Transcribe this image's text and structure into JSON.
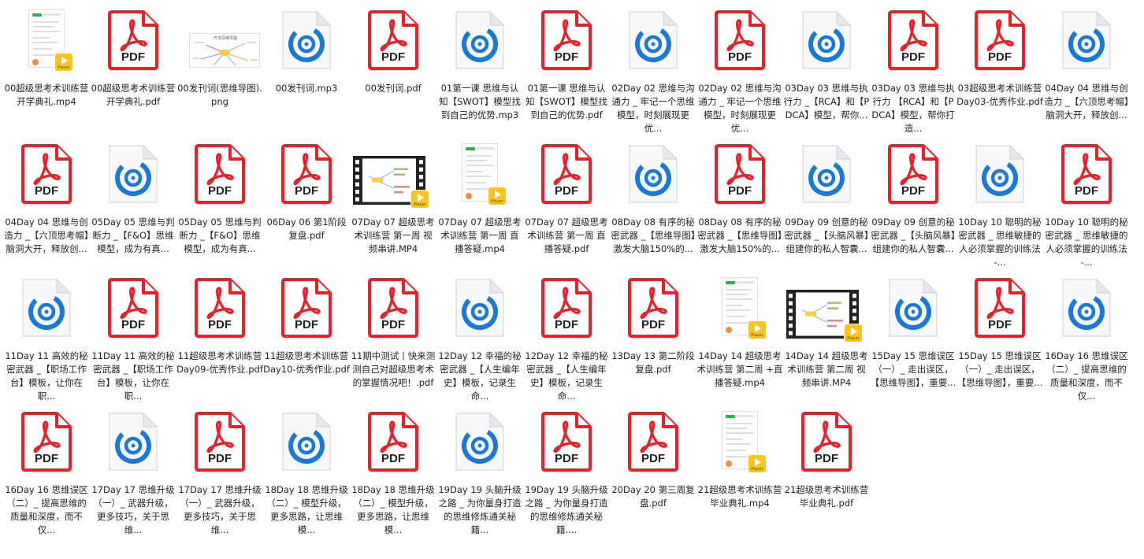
{
  "folder": {
    "files": [
      {
        "name": "00超级思考术训练营开学典礼.mp4",
        "type": "video-phone"
      },
      {
        "name": "00超级思考术训练营开学典礼.pdf",
        "type": "pdf"
      },
      {
        "name": "00发刊词(思维导图).png",
        "type": "image"
      },
      {
        "name": "00发刊词.mp3",
        "type": "audio"
      },
      {
        "name": "00发刊词.pdf",
        "type": "pdf"
      },
      {
        "name": "01第一课 思维与认知【SWOT】模型找到自己的优势.mp3",
        "type": "audio"
      },
      {
        "name": "01第一课 思维与认知【SWOT】模型找到自己的优势.pdf",
        "type": "pdf"
      },
      {
        "name": "02Day 02 思维与沟通力 _ 牢记一个思维模型，时刻展现更优...",
        "type": "audio"
      },
      {
        "name": "02Day 02 思维与沟通力 _ 牢记一个思维模型，时刻展现更优...",
        "type": "pdf"
      },
      {
        "name": "03Day 03 思维与执行力 _【RCA】和【PDCA】模型，帮你...",
        "type": "audio"
      },
      {
        "name": "03Day 03 思维与执行力 【RCA】和【PDCA】模型，帮你打造...",
        "type": "pdf"
      },
      {
        "name": "03超级思考术训练营 Day03-优秀作业.pdf",
        "type": "pdf"
      },
      {
        "name": "04Day 04 思维与创造力 _【六顶思考帽】脑洞大开，释放创...",
        "type": "audio"
      },
      {
        "name": "04Day 04 思维与创造力 _【六顶思考帽】脑洞大开，释放创...",
        "type": "pdf"
      },
      {
        "name": "05Day 05 思维与判断力 _【F&O】思维模型，成为有真...",
        "type": "audio"
      },
      {
        "name": "05Day 05 思维与判断力 _【F&O】思维模型，成为有真...",
        "type": "pdf"
      },
      {
        "name": "06Day 06 第1阶段 复盘.pdf",
        "type": "pdf"
      },
      {
        "name": "07Day 07 超级思考术训练营 第一周 视频串讲.MP4",
        "type": "video-film"
      },
      {
        "name": "07Day 07 超级思考术训练营 第一周 直播答疑.mp4",
        "type": "video-phone"
      },
      {
        "name": "07Day 07 超级思考术训练营 第一周 直播答疑.pdf",
        "type": "pdf"
      },
      {
        "name": "08Day 08 有序的秘密武器 _【思维导图】激发大脑150%的...",
        "type": "audio"
      },
      {
        "name": "08Day 08 有序的秘密武器 _【思维导图】激发大脑150%的...",
        "type": "pdf"
      },
      {
        "name": "09Day 09 创意的秘密武器 _【头脑风暴】组建你的私人智囊...",
        "type": "audio"
      },
      {
        "name": "09Day 09 创意的秘密武器 _【头脑风暴】组建你的私人智囊...",
        "type": "pdf"
      },
      {
        "name": "10Day 10 聪明的秘密武器 _ 思维敏捷的人必须掌握的训练法 -...",
        "type": "audio"
      },
      {
        "name": "10Day 10 聪明的秘密武器 _ 思维敏捷的人必须掌握的训练法 -...",
        "type": "pdf"
      },
      {
        "name": "11Day 11 高效的秘密武器 _【职场工作台】模板，让你在职...",
        "type": "audio"
      },
      {
        "name": "11Day 11 高效的秘密武器 _【职场工作台】模板，让你在职...",
        "type": "pdf"
      },
      {
        "name": "11超级思考术训练营 Day09-优秀作业.pdf",
        "type": "pdf"
      },
      {
        "name": "11超级思考术训练营 Day10-优秀作业.pdf",
        "type": "pdf"
      },
      {
        "name": "11期中测试丨快来测测自己对超级思考术的掌握情况吧！.pdf",
        "type": "pdf"
      },
      {
        "name": "12Day 12 幸福的秘密武器 _【人生编年史】模板，记录生命...",
        "type": "audio"
      },
      {
        "name": "12Day 12 幸福的秘密武器 _【人生编年史】模板，记录生命...",
        "type": "pdf"
      },
      {
        "name": "13Day 13 第二阶段 复盘.pdf",
        "type": "pdf"
      },
      {
        "name": "14Day 14 超级思考术训练营 第二周 +直播答疑.mp4",
        "type": "video-phone"
      },
      {
        "name": "14Day 14 超级思考术训练营 第二周 视频串讲.MP4",
        "type": "video-film"
      },
      {
        "name": "15Day 15 思维误区（一）_ 走出误区，【思维导图】，重要...",
        "type": "audio"
      },
      {
        "name": "15Day 15 思维误区（一）_ 走出误区，【思维导图】，重要...",
        "type": "pdf"
      },
      {
        "name": "16Day 16 思维误区（二）_ 提高思维的质量和深度，而不仅...",
        "type": "audio"
      },
      {
        "name": "16Day 16 思维误区（二）_ 提高思维的质量和深度，而不仅...",
        "type": "pdf"
      },
      {
        "name": "17Day 17 思维升级（一）_ 武器升级，更多技巧，关于思维...",
        "type": "audio"
      },
      {
        "name": "17Day 17 思维升级（一）_ 武器升级，更多技巧，关于思维...",
        "type": "pdf"
      },
      {
        "name": "18Day 18 思维升级（二）_ 模型升级，更多思路，让思维模...",
        "type": "audio"
      },
      {
        "name": "18Day 18 思维升级（二）_ 模型升级，更多思路，让思维模...",
        "type": "pdf"
      },
      {
        "name": "19Day 19 头脑升级之路 _ 为你量身打造的思维修炼通关秘籍...",
        "type": "audio"
      },
      {
        "name": "19Day 19 头脑升级之路 _ 为你量身打造的思维修炼通关秘籍....",
        "type": "pdf"
      },
      {
        "name": "20Day 20 第三周复盘.pdf",
        "type": "pdf"
      },
      {
        "name": "21超级思考术训练营毕业典礼.mp4",
        "type": "video-phone"
      },
      {
        "name": "21超级思考术训练营毕业典礼.pdf",
        "type": "pdf"
      }
    ]
  },
  "icons": {
    "pdf_text": "PDF",
    "player_text": "Player",
    "image_thumb_title": "开发思维导图",
    "pdf_color": "#e8202a",
    "audio_color": "#1a78d6",
    "player_color": "#f7c51d"
  }
}
